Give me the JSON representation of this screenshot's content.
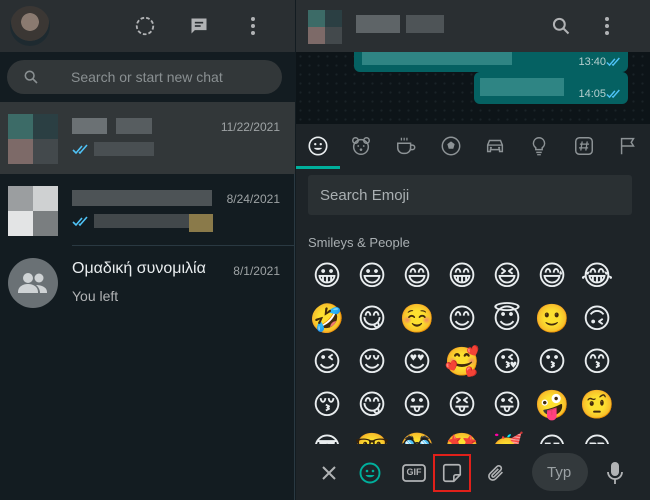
{
  "left_header": {
    "icons": [
      "status-icon",
      "new-chat-icon",
      "menu-icon"
    ]
  },
  "search": {
    "placeholder": "Search or start new chat"
  },
  "chats": [
    {
      "name": "",
      "date": "11/22/2021",
      "subtitle": "",
      "active": true,
      "read_ticks": true
    },
    {
      "name": "",
      "date": "8/24/2021",
      "subtitle": "",
      "active": false,
      "read_ticks": true
    },
    {
      "name": "Ομαδική συνομιλία",
      "date": "8/1/2021",
      "subtitle": "You left",
      "active": false,
      "read_ticks": false
    }
  ],
  "conversation": {
    "messages": [
      {
        "time": "13:40",
        "outgoing": true,
        "read": true
      },
      {
        "time": "14:05",
        "outgoing": true,
        "read": true
      }
    ]
  },
  "emoji_panel": {
    "categories": [
      "smiley-icon",
      "animal-icon",
      "food-icon",
      "activity-icon",
      "travel-icon",
      "objects-icon",
      "symbols-icon",
      "flag-icon"
    ],
    "active_category": 0,
    "search_placeholder": "Search Emoji",
    "section_title": "Smileys & People",
    "emojis": [
      "😀",
      "😃",
      "😄",
      "😁",
      "😆",
      "😅",
      "😂",
      "🤣",
      "😋",
      "☺️",
      "😊",
      "😇",
      "🙂",
      "🙃",
      "😉",
      "😌",
      "😍",
      "🥰",
      "😘",
      "😗",
      "😙",
      "😚",
      "😋",
      "😛",
      "😝",
      "😜",
      "🤪",
      "🤨",
      "😎",
      "🤓",
      "🥸",
      "🤩",
      "🥳",
      "😏",
      "😒"
    ]
  },
  "footer": {
    "icons": [
      "close-icon",
      "emoji-tab-icon",
      "gif-icon",
      "sticker-icon",
      "attach-icon",
      "microphone-icon"
    ],
    "gif_label": "GIF",
    "type_placeholder": "Typ"
  },
  "colors": {
    "accent": "#00af9c",
    "bubble_out": "#056162",
    "read_ticks": "#4fc3f7",
    "highlight": "#e0201a"
  }
}
